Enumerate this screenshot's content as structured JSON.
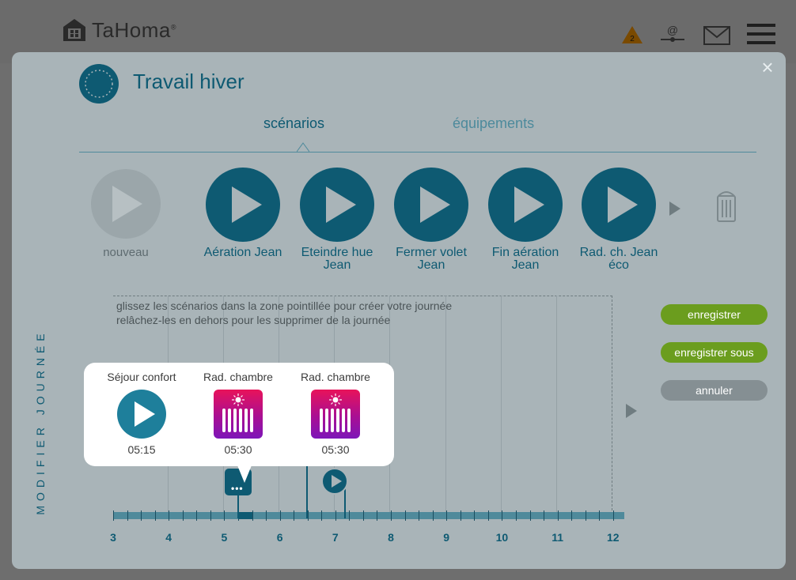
{
  "header": {
    "brand": "TaHoma",
    "brand_mark": "®",
    "alert_count": "2"
  },
  "modal": {
    "title": "Travail hiver",
    "tabs": [
      {
        "label": "scénarios"
      },
      {
        "label": "équipements"
      }
    ],
    "new_label": "nouveau",
    "scenarios": [
      {
        "label": "Aération Jean"
      },
      {
        "label": "Eteindre hue Jean"
      },
      {
        "label": "Fermer volet Jean"
      },
      {
        "label": "Fin aération Jean"
      },
      {
        "label": "Rad. ch. Jean éco"
      }
    ],
    "side_label": "MODIFIER JOURNÉE",
    "hint_line1": "glissez les scénarios dans la zone pointillée pour créer votre journée",
    "hint_line2": "relâchez-les en dehors pour les supprimer de la journée",
    "axis": [
      "3",
      "4",
      "5",
      "6",
      "7",
      "8",
      "9",
      "10",
      "11",
      "12"
    ],
    "buttons": {
      "save": "enregistrer",
      "save_as": "enregistrer sous",
      "cancel": "annuler"
    },
    "popup": [
      {
        "name": "Séjour confort",
        "time": "05:15",
        "icon": "play-icon"
      },
      {
        "name": "Rad. chambre",
        "time": "05:30",
        "icon": "radiator-icon"
      },
      {
        "name": "Rad. chambre",
        "time": "05:30",
        "icon": "radiator-icon"
      }
    ]
  },
  "colors": {
    "accent": "#0e5a72",
    "green": "#6b9d1e",
    "radiator_top": "#e8135a",
    "radiator_bottom": "#7d16b8"
  }
}
